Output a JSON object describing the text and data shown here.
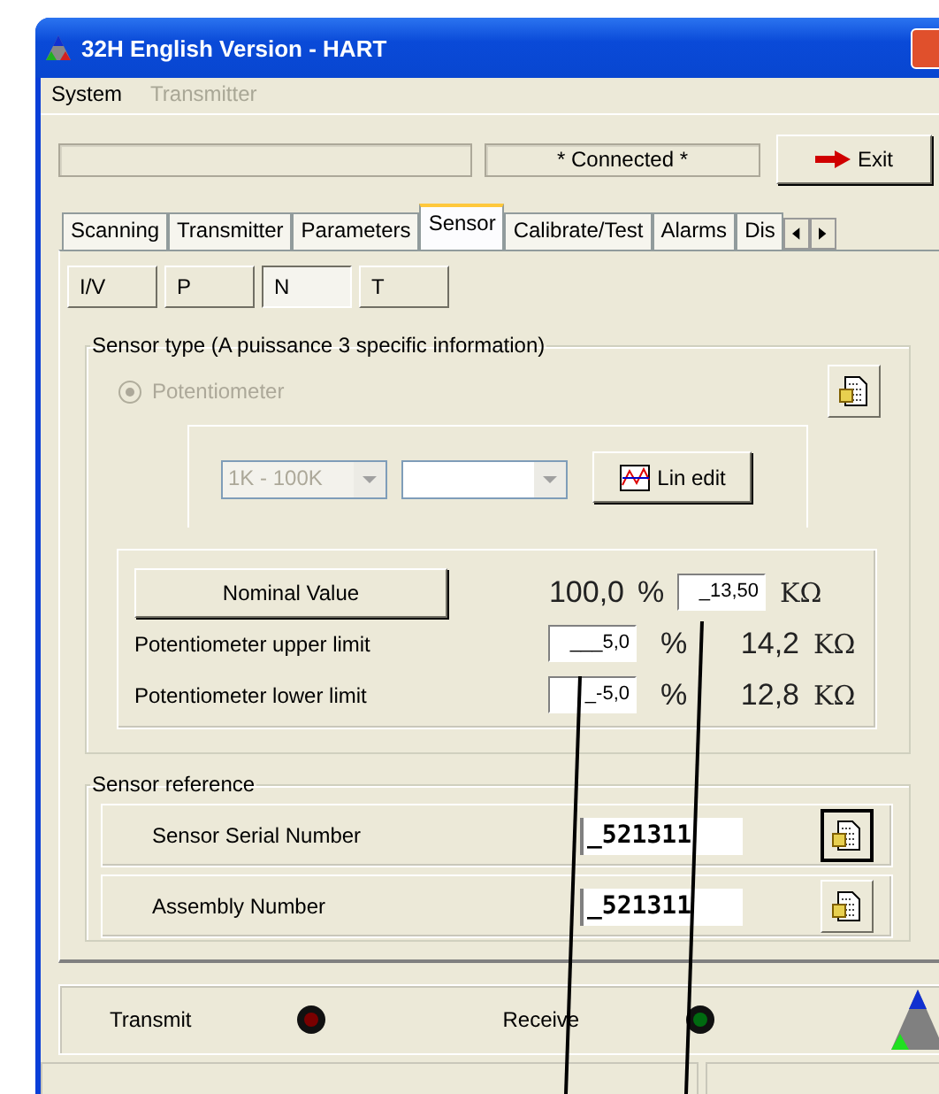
{
  "window": {
    "title": "32H English Version - HART"
  },
  "menu": [
    {
      "label": "System",
      "disabled": false
    },
    {
      "label": "Transmitter",
      "disabled": true
    }
  ],
  "connection_status": "* Connected *",
  "exit_button": "Exit",
  "tabs": [
    {
      "label": "Scanning",
      "selected": false
    },
    {
      "label": "Transmitter",
      "selected": false
    },
    {
      "label": "Parameters",
      "selected": false
    },
    {
      "label": "Sensor",
      "selected": true
    },
    {
      "label": "Calibrate/Test",
      "selected": false
    },
    {
      "label": "Alarms",
      "selected": false
    },
    {
      "label": "Dis",
      "selected": false
    }
  ],
  "sub_tabs": [
    {
      "label": "I/V",
      "selected": false
    },
    {
      "label": "P",
      "selected": false
    },
    {
      "label": "N",
      "selected": true
    },
    {
      "label": "T",
      "selected": false
    }
  ],
  "sensor_type": {
    "title": "Sensor type (A puissance 3 specific information)",
    "radio": {
      "label": "Potentiometer",
      "checked": true,
      "disabled": true
    },
    "range_select": {
      "value": "1K - 100K",
      "disabled": true
    },
    "lin_edit_button": "Lin edit",
    "nominal": {
      "button": "Nominal Value",
      "percent": "100,0",
      "percent_unit": "%",
      "value": "_13,50",
      "unit": "KΩ"
    },
    "limits": [
      {
        "label": "Potentiometer upper limit",
        "value": "___5,0",
        "percent_unit": "%",
        "resistance": "14,2",
        "unit": "KΩ"
      },
      {
        "label": "Potentiometer lower limit",
        "value": "_-5,0",
        "percent_unit": "%",
        "resistance": "12,8",
        "unit": "KΩ"
      }
    ]
  },
  "sensor_reference": {
    "title": "Sensor reference",
    "rows": [
      {
        "label": "Sensor Serial Number",
        "value": "_521311",
        "pressed": true
      },
      {
        "label": "Assembly Number",
        "value": "_521311",
        "pressed": false
      }
    ]
  },
  "signals": [
    {
      "label": "Transmit",
      "color": "#7a0000"
    },
    {
      "label": "Receive",
      "color": "#006a10"
    }
  ]
}
